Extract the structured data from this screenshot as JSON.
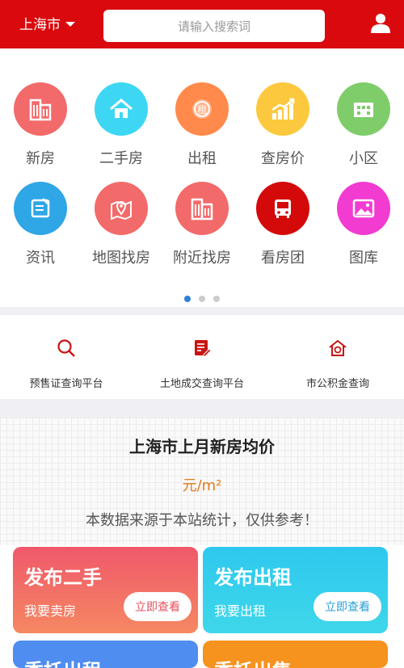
{
  "header": {
    "city": "上海市",
    "search_placeholder": "请输入搜索词"
  },
  "grid": [
    {
      "label": "新房",
      "color": "#f26a6a",
      "icon": "building-icon"
    },
    {
      "label": "二手房",
      "color": "#3ed7f3",
      "icon": "house-icon"
    },
    {
      "label": "出租",
      "color": "#ff8a4c",
      "icon": "rent-icon"
    },
    {
      "label": "查房价",
      "color": "#fcc93e",
      "icon": "price-chart-icon"
    },
    {
      "label": "小区",
      "color": "#7fcd6a",
      "icon": "community-icon"
    },
    {
      "label": "资讯",
      "color": "#2fa6e6",
      "icon": "news-icon"
    },
    {
      "label": "地图找房",
      "color": "#f26a6a",
      "icon": "map-pin-icon"
    },
    {
      "label": "附近找房",
      "color": "#f26a6a",
      "icon": "nearby-building-icon"
    },
    {
      "label": "看房团",
      "color": "#d40a0a",
      "icon": "bus-icon"
    },
    {
      "label": "图库",
      "color": "#f13bd1",
      "icon": "gallery-icon"
    }
  ],
  "tools": [
    {
      "label": "预售证查询平台",
      "icon": "search-icon"
    },
    {
      "label": "土地成交查询平台",
      "icon": "document-edit-icon"
    },
    {
      "label": "市公积金查询",
      "icon": "home-fund-icon"
    }
  ],
  "price": {
    "title": "上海市上月新房均价",
    "unit": "元/m²",
    "note": "本数据来源于本站统计，仅供参考！"
  },
  "cards": [
    {
      "title": "发布二手",
      "subtitle": "我要卖房",
      "button": "立即查看"
    },
    {
      "title": "发布出租",
      "subtitle": "我要出租",
      "button": "立即查看"
    },
    {
      "title": "委托出租"
    },
    {
      "title": "委托出售"
    }
  ]
}
